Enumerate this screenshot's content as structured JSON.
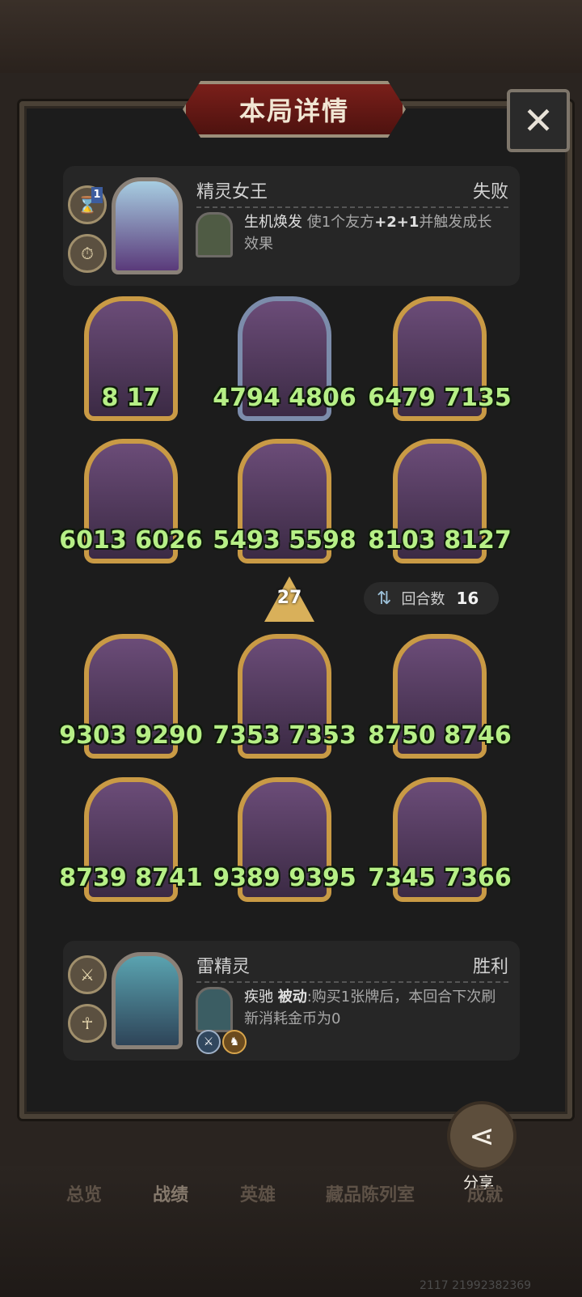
{
  "title": "本局详情",
  "close_icon": "close-icon",
  "top_player": {
    "hero_name": "精灵女王",
    "result": "失败",
    "level_badge": "1",
    "skill_name": "生机焕发",
    "skill_desc_pre": "使1个友方",
    "skill_desc_bold": "+2+1",
    "skill_desc_post": "并触发成长效果"
  },
  "board_top": [
    {
      "attack": "8",
      "health": "17"
    },
    {
      "attack": "4794",
      "health": "4806"
    },
    {
      "attack": "6479",
      "health": "7135"
    },
    {
      "attack": "6013",
      "health": "6026"
    },
    {
      "attack": "5493",
      "health": "5598"
    },
    {
      "attack": "8103",
      "health": "8127"
    }
  ],
  "turn_marker": "27",
  "rounds": {
    "label": "回合数",
    "value": "16"
  },
  "board_bottom": [
    {
      "attack": "9303",
      "health": "9290"
    },
    {
      "attack": "7353",
      "health": "7353"
    },
    {
      "attack": "8750",
      "health": "8746"
    },
    {
      "attack": "8739",
      "health": "8741"
    },
    {
      "attack": "9389",
      "health": "9395"
    },
    {
      "attack": "7345",
      "health": "7366"
    }
  ],
  "bottom_player": {
    "hero_name": "雷精灵",
    "result": "胜利",
    "skill_name": "疾驰",
    "skill_type": "被动",
    "skill_desc": ":购买1张牌后，本回合下次刷新消耗金币为0"
  },
  "share_label": "分享",
  "tabs": [
    "总览",
    "战绩",
    "英雄",
    "藏品陈列室",
    "成就"
  ],
  "footer_id": "2117 21992382369"
}
